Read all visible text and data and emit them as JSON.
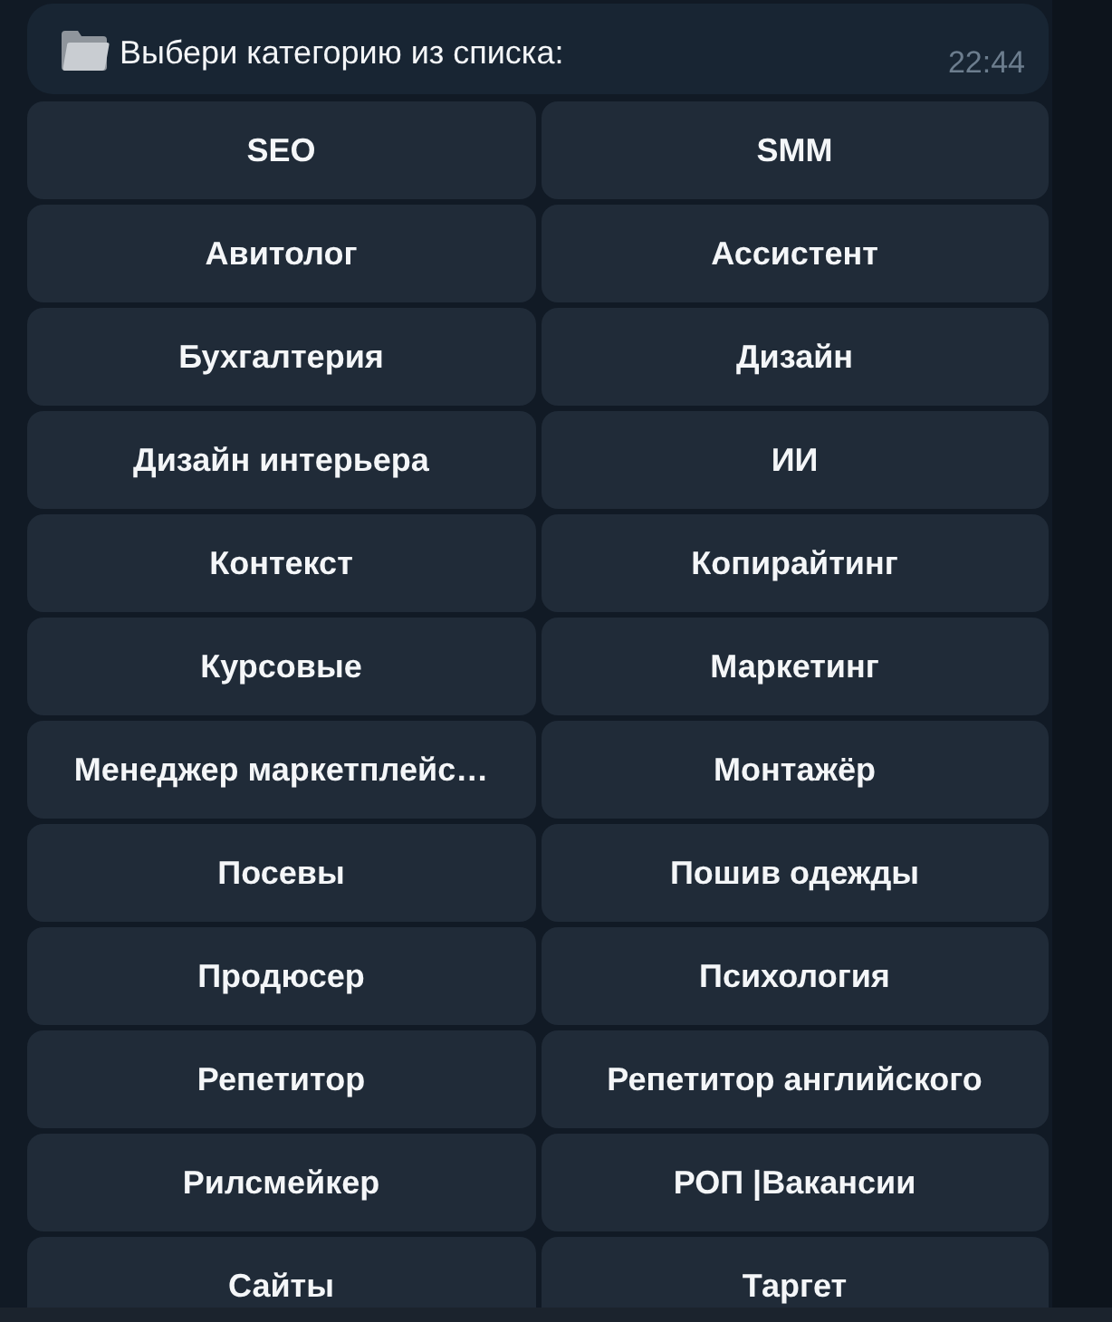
{
  "message": {
    "text": "Выбери категорию из списка:",
    "time": "22:44"
  },
  "keyboard": {
    "rows": [
      [
        {
          "label": "SEO"
        },
        {
          "label": "SMM"
        }
      ],
      [
        {
          "label": "Авитолог"
        },
        {
          "label": "Ассистент"
        }
      ],
      [
        {
          "label": "Бухгалтерия"
        },
        {
          "label": "Дизайн"
        }
      ],
      [
        {
          "label": "Дизайн интерьера"
        },
        {
          "label": "ИИ"
        }
      ],
      [
        {
          "label": "Контекст"
        },
        {
          "label": "Копирайтинг"
        }
      ],
      [
        {
          "label": "Курсовые"
        },
        {
          "label": "Маркетинг"
        }
      ],
      [
        {
          "label": "Менеджер маркетплейс…"
        },
        {
          "label": "Монтажёр"
        }
      ],
      [
        {
          "label": "Посевы"
        },
        {
          "label": "Пошив одежды"
        }
      ],
      [
        {
          "label": "Продюсер"
        },
        {
          "label": "Психология"
        }
      ],
      [
        {
          "label": "Репетитор"
        },
        {
          "label": "Репетитор английского"
        }
      ],
      [
        {
          "label": "Рилсмейкер"
        },
        {
          "label": "РОП |Вакансии"
        }
      ],
      [
        {
          "label": "Сайты"
        },
        {
          "label": "Таргет"
        }
      ]
    ]
  }
}
